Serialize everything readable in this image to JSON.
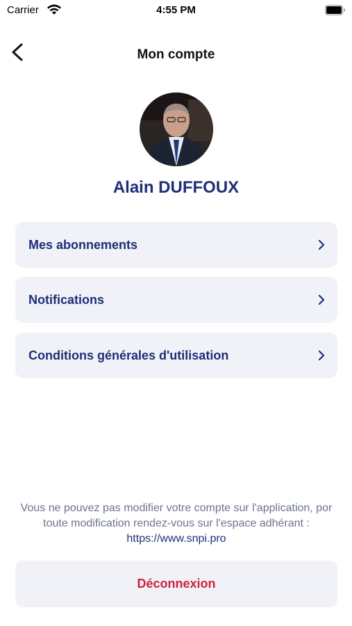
{
  "status_bar": {
    "carrier": "Carrier",
    "time": "4:55 PM",
    "wifi_icon": "wifi-icon",
    "battery_icon": "battery-icon"
  },
  "nav": {
    "title": "Mon compte",
    "back_icon": "chevron-left-icon"
  },
  "profile": {
    "name": "Alain DUFFOUX"
  },
  "menu": {
    "items": [
      {
        "label": "Mes abonnements",
        "icon": "chevron-right-icon"
      },
      {
        "label": "Notifications",
        "icon": "chevron-right-icon"
      },
      {
        "label": "Conditions générales d'utilisation",
        "icon": "chevron-right-icon"
      }
    ]
  },
  "footer": {
    "info_text": "Vous ne pouvez pas modifier votre compte sur l'application, por toute modification rendez-vous sur l'espace adhérant : ",
    "info_link": "https://www.snpi.pro",
    "logout_label": "Déconnexion"
  },
  "colors": {
    "primary": "#1c2f78",
    "danger": "#d01f3c",
    "card_bg": "#f1f2f7",
    "muted_text": "#6b7488"
  }
}
